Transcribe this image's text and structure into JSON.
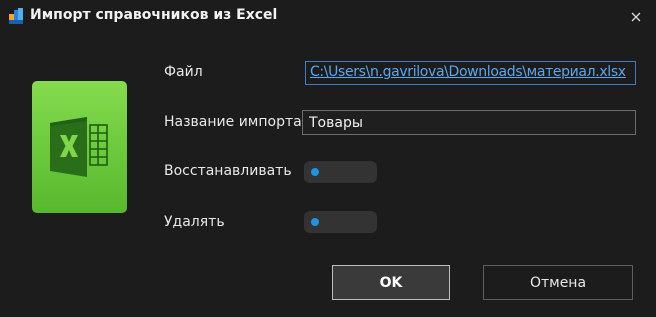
{
  "window": {
    "title": "Импорт справочников из Excel",
    "app_icon": "app-icon",
    "close_icon": "close-icon"
  },
  "logo": {
    "icon": "excel-icon",
    "letter": "X",
    "color": "#6fcc3e"
  },
  "form": {
    "file_label": "Файл",
    "file_path": "C:\\Users\\n.gavrilova\\Downloads\\материал.xlsx",
    "import_name_label": "Название импорта",
    "import_name_value": "Товары",
    "restore_label": "Восстанавливать",
    "restore_enabled": false,
    "delete_label": "Удалять",
    "delete_enabled": false
  },
  "buttons": {
    "ok_label": "OK",
    "cancel_label": "Отмена"
  },
  "colors": {
    "accent": "#1d95e3",
    "link": "#5aa7ec",
    "background": "#1c1c1c"
  }
}
